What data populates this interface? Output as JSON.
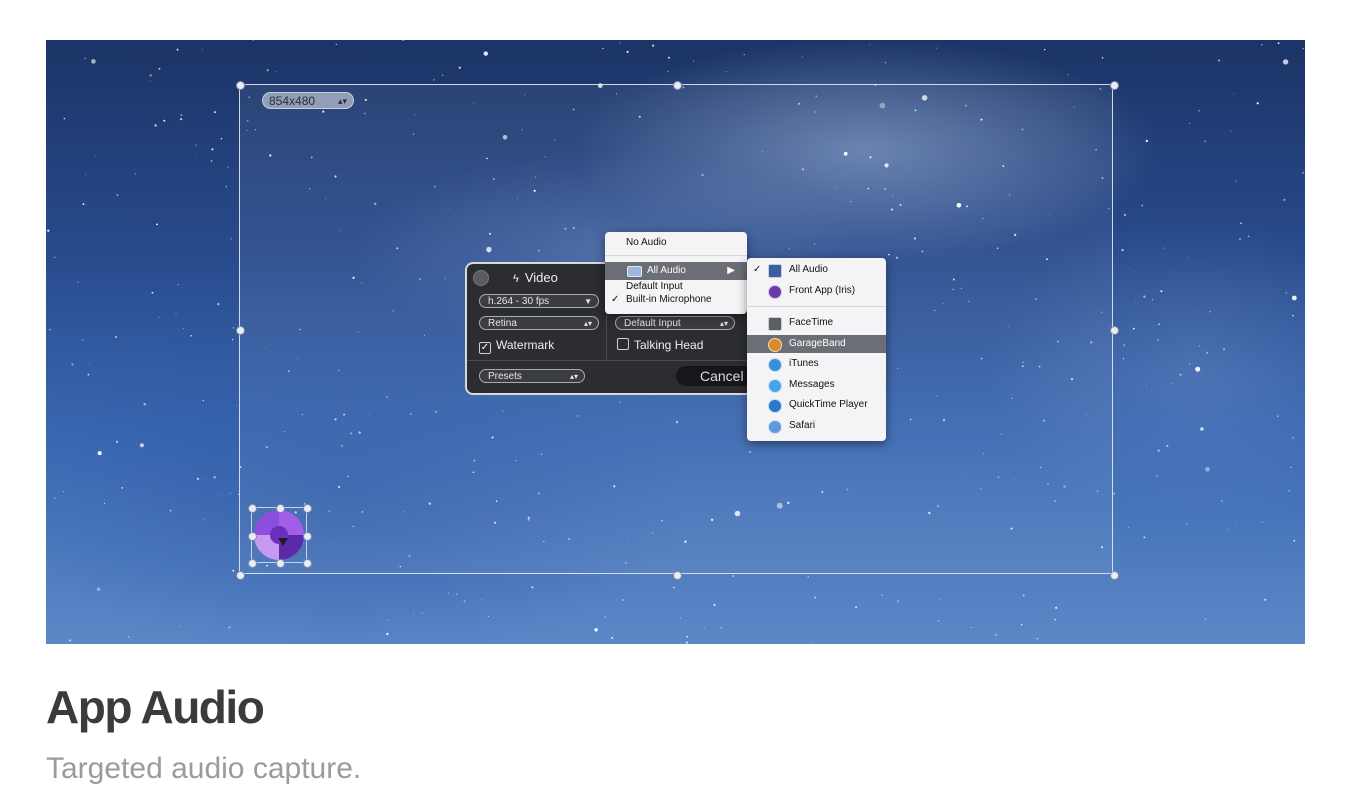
{
  "page": {
    "title": "App Audio",
    "subtitle": "Targeted audio capture."
  },
  "overlay": {
    "resolution": "854x480",
    "stepper_glyph": "▴▾"
  },
  "panel": {
    "video_label": "Video",
    "video_icon": "lightning-icon",
    "codec": "h.264 - 30 fps",
    "quality": "Retina",
    "watermark_label": "Watermark",
    "watermark_checked": true,
    "audio_input": "Default Input",
    "talking_head_label": "Talking Head",
    "talking_head_checked": false,
    "presets": "Presets",
    "cancel_label": "Cancel"
  },
  "audio_menu": {
    "items": [
      {
        "label": "No Audio",
        "checked": false
      },
      {
        "label": "All Audio",
        "checked": false,
        "highlighted": true,
        "submenu": true
      },
      {
        "label": "Default Input",
        "checked": false
      },
      {
        "label": "Built-in Microphone",
        "checked": true
      }
    ]
  },
  "app_menu": {
    "items": [
      {
        "label": "All Audio",
        "checked": true,
        "icon": "display-icon",
        "color": "#3a5f9c"
      },
      {
        "label": "Front App (Iris)",
        "checked": false,
        "icon": "iris-icon",
        "color": "#6a3ca8"
      },
      {
        "label": "FaceTime",
        "checked": false,
        "icon": "camera-icon",
        "color": "#5a5f66"
      },
      {
        "label": "GarageBand",
        "checked": false,
        "highlighted": true,
        "icon": "guitar-icon",
        "color": "#d98a2b"
      },
      {
        "label": "iTunes",
        "checked": false,
        "icon": "music-icon",
        "color": "#3b8ed8"
      },
      {
        "label": "Messages",
        "checked": false,
        "icon": "chat-icon",
        "color": "#48a4e8"
      },
      {
        "label": "QuickTime Player",
        "checked": false,
        "icon": "play-icon",
        "color": "#2a78c8"
      },
      {
        "label": "Safari",
        "checked": false,
        "icon": "compass-icon",
        "color": "#5e9ad8"
      }
    ]
  },
  "colors": {
    "title": "#3b3b3b",
    "subtitle": "#9b9b9b",
    "menu_highlight": "#6c6e75"
  }
}
